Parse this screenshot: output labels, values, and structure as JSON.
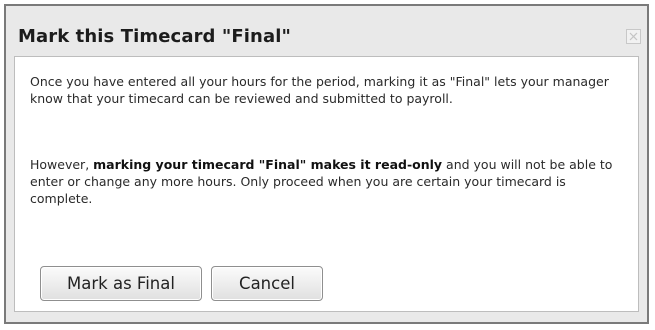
{
  "dialog": {
    "title": "Mark this Timecard \"Final\"",
    "close_icon": "close-icon",
    "para1": "Once you have entered all your hours for the period, marking it as \"Final\" lets your manager know that your timecard can be reviewed and submitted to payroll.",
    "para2_before": "However, ",
    "para2_bold": "marking your timecard \"Final\" makes it read-only",
    "para2_after": " and you will not be able to enter or change any more hours. Only proceed when you are certain your timecard is complete.",
    "mark_final_label": "Mark as Final",
    "cancel_label": "Cancel"
  }
}
